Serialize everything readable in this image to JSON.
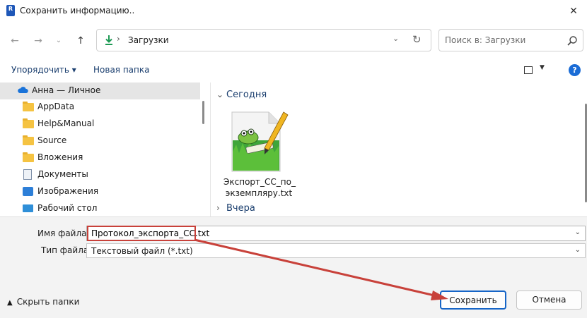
{
  "window": {
    "title": "Сохранить информацию..",
    "app_icon_letter": "R"
  },
  "nav": {
    "address_path": "Загрузки",
    "search_placeholder": "Поиск в: Загрузки"
  },
  "toolbar": {
    "organize_label": "Упорядочить ▾",
    "new_folder_label": "Новая папка",
    "help_label": "?"
  },
  "sidebar": {
    "items": [
      {
        "label": "Анна — Личное",
        "icon": "cloud-icon",
        "selected": true
      },
      {
        "label": "AppData",
        "icon": "folder-icon"
      },
      {
        "label": "Help&Manual",
        "icon": "folder-icon"
      },
      {
        "label": "Source",
        "icon": "folder-icon"
      },
      {
        "label": "Вложения",
        "icon": "folder-icon"
      },
      {
        "label": "Документы",
        "icon": "documents-icon"
      },
      {
        "label": "Изображения",
        "icon": "pictures-icon"
      },
      {
        "label": "Рабочий стол",
        "icon": "desktop-icon"
      }
    ]
  },
  "main": {
    "group_today": "Сегодня",
    "group_yesterday": "Вчера",
    "file": {
      "name_line1": "Экспорт_CC_по_",
      "name_line2": "экземпляру.txt",
      "icon": "notepad-plus-plus-icon"
    }
  },
  "form": {
    "filename_label": "Имя файла:",
    "filename_value": "Протокол_экспорта_CC.txt",
    "filetype_label": "Тип файла:",
    "filetype_value": "Текстовый файл (*.txt)"
  },
  "footer": {
    "hide_folders_label": "Скрыть папки",
    "save_label": "Сохранить",
    "cancel_label": "Отмена"
  },
  "colors": {
    "accent": "#1665c7",
    "annotation": "#c8413a",
    "folder": "#f5c342"
  }
}
